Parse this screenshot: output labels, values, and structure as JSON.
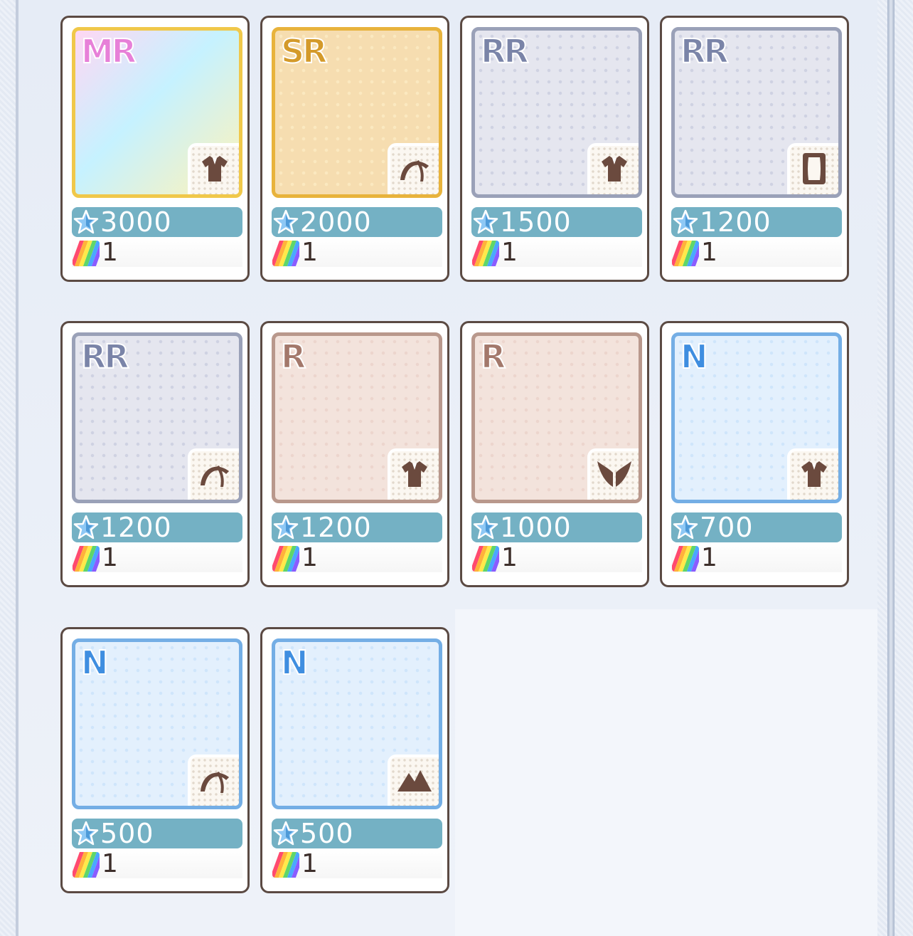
{
  "colors": {
    "price_bar": "#74b1c4",
    "card_border": "#5b4a43",
    "price_text": "#ffffff",
    "qty_text": "#3d2f2b"
  },
  "items": [
    {
      "rarity": "MR",
      "rarity_class": "mr",
      "category_icon": "dress-icon",
      "price": "3000",
      "quantity": "1"
    },
    {
      "rarity": "SR",
      "rarity_class": "sr",
      "category_icon": "hair-icon",
      "price": "2000",
      "quantity": "1"
    },
    {
      "rarity": "RR",
      "rarity_class": "rr",
      "category_icon": "dress-icon",
      "price": "1500",
      "quantity": "1"
    },
    {
      "rarity": "RR",
      "rarity_class": "rr",
      "category_icon": "frame-icon",
      "price": "1200",
      "quantity": "1"
    },
    {
      "rarity": "RR",
      "rarity_class": "rr",
      "category_icon": "hair-icon",
      "price": "1200",
      "quantity": "1"
    },
    {
      "rarity": "R",
      "rarity_class": "r",
      "category_icon": "dress-icon",
      "price": "1200",
      "quantity": "1"
    },
    {
      "rarity": "R",
      "rarity_class": "r",
      "category_icon": "wings-icon",
      "price": "1000",
      "quantity": "1"
    },
    {
      "rarity": "N",
      "rarity_class": "n",
      "category_icon": "dress-icon",
      "price": "700",
      "quantity": "1"
    },
    {
      "rarity": "N",
      "rarity_class": "n",
      "category_icon": "hair-icon",
      "price": "500",
      "quantity": "1"
    },
    {
      "rarity": "N",
      "rarity_class": "n",
      "category_icon": "mountain-icon",
      "price": "500",
      "quantity": "1"
    }
  ]
}
